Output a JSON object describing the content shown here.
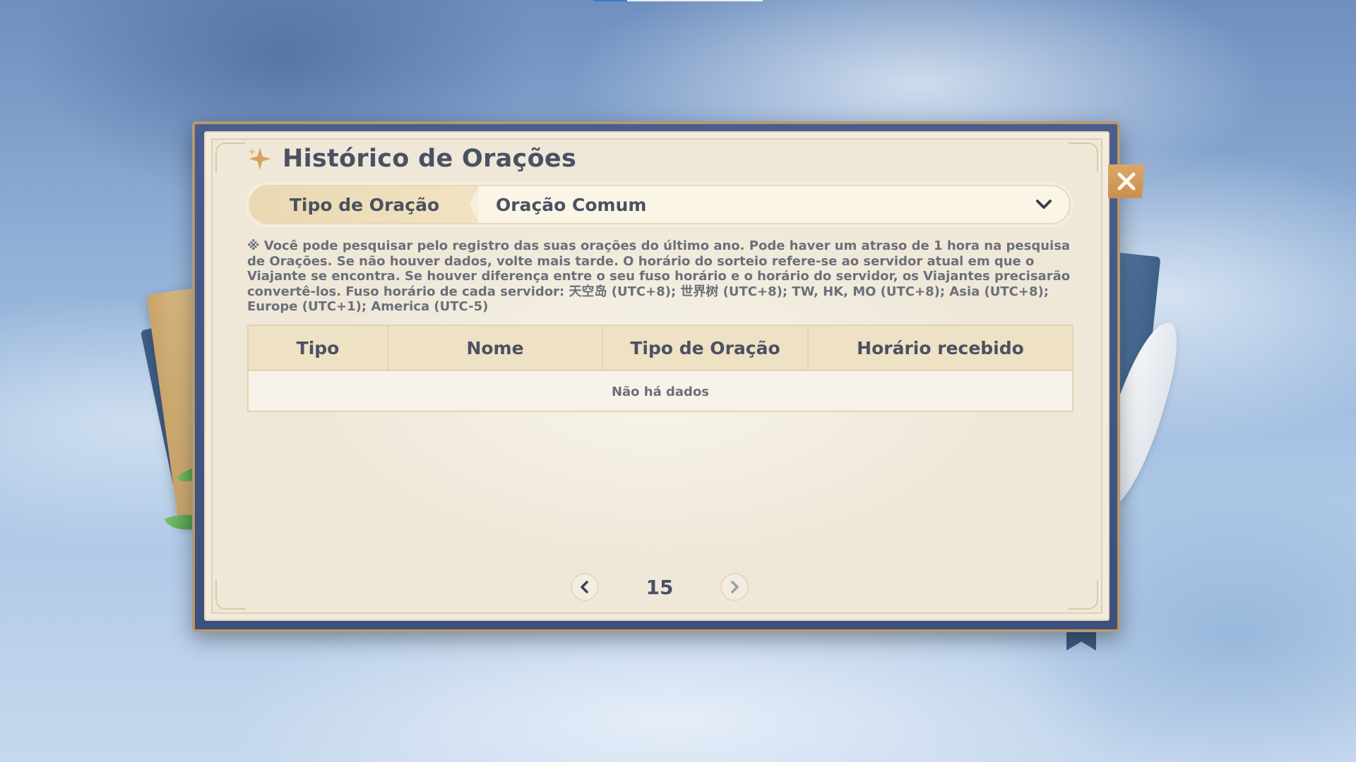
{
  "title": "Histórico de Orações",
  "selector": {
    "label": "Tipo de Oração",
    "value": "Oração Comum"
  },
  "note": "※ Você pode pesquisar pelo registro das suas orações do último ano. Pode haver um atraso de 1 hora na pesquisa de Orações. Se não houver dados, volte mais tarde. O horário do sorteio refere-se ao servidor atual em que o Viajante se encontra. Se houver diferença entre o seu fuso horário e o horário do servidor, os Viajantes precisarão convertê-los. Fuso horário de cada servidor: 天空岛 (UTC+8); 世界树 (UTC+8); TW, HK, MO (UTC+8); Asia (UTC+8); Europe (UTC+1); America (UTC-5)",
  "table": {
    "columns": [
      "Tipo",
      "Nome",
      "Tipo de Oração",
      "Horário recebido"
    ],
    "empty_text": "Não há dados"
  },
  "pagination": {
    "page": "15"
  },
  "icons": {
    "title": "sparkle-icon",
    "close": "close-icon",
    "dropdown": "chevron-down-icon",
    "prev": "chevron-left-icon",
    "next": "chevron-right-icon"
  },
  "colors": {
    "text": "#4b5163",
    "accent_gold": "#d7a45d",
    "frame": "#3d4f7c"
  }
}
